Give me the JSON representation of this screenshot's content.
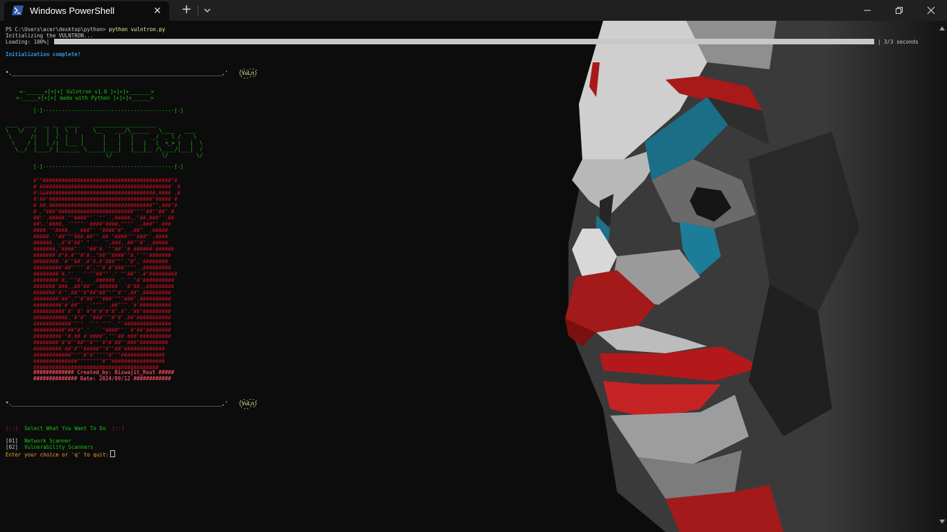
{
  "window": {
    "tab_title": "Windows PowerShell",
    "icons": {
      "tab_icon": "powershell-icon",
      "close": "close-icon",
      "new_tab": "plus-icon",
      "dropdown": "chevron-down-icon",
      "minimize": "minimize-icon",
      "maximize": "restore-icon",
      "close_window": "close-icon"
    },
    "colors": {
      "titlebar": "#202020",
      "terminal_bg": "#0c0c0c"
    }
  },
  "terminal": {
    "prompt": "PS C:\\Users\\acer\\desktop\\python>",
    "command": "python vulntron.py",
    "init_line": "Initializing the VULNTRON...",
    "loading_label": "Loading: 100%|",
    "loading_percent": 100,
    "loading_suffix": "| 3/3 seconds",
    "init_complete": "Initialization complete!",
    "divider_top": "*.___________________________________________________________________,'",
    "vuln_badge_top": ".-.--.",
    "vuln_badge": "(VuLn)",
    "vuln_badge_bottom": "'--''",
    "version_line": "<-______+[+[+[ Vulntron v1.0 ]+]+]+_______>",
    "python_line": "<-_____+[+[+[ made with Python ]+]+]+______>",
    "frame_line": "[-]------------------------------------------[-]",
    "banner": [
      "____  ____  __ __  _____    ____________________",
      "\\   \\/   /   |  |  \\  |     \\__    ___/\\______   \\____   ____",
      " \\      /|   |  /  |    |      |    |   |      _/  _ \\ /    \\",
      "  \\    / |   | /|  |___ |      |    |   |   |   (  <_> )   |  \\",
      "   \\__/  |____/ |_______ \\_____|____|   |___|__ /\\____/|___|  /",
      "                                \\/                \\/         \\/"
    ],
    "mask_lines": [
      "#\"\"#########################################\"#",
      "# ##########################################' #",
      "#!&&###################################,#### ,#",
      "#!##\"#################################\"##### #",
      "# ##,#################################\"\",###\"#",
      "# ,\"###\"########################\"\"\"\"##\"\"##\" #",
      "##\\'.#####.\"\"####\"\"`'\"\"`.,#####,.\"##,###\"',##",
      "##\\.'####,.'\"\"\"\"'`####\"####,\"\"\"\"`.,###\"'.###",
      "####.'\"####, _ ###\"' \"####\"#\", ,##\"  ,#####",
      "#####.'\"##\"\"\"###.##\"\" ## \"####\"\"'###\"',####",
      "######..,#\"#\"##\" \" ``  \",###,.##\"\"#\".,#####",
      "#######,'####\"' `\"##\"#.`\"\"##\"'# ######`######",
      "#######'#\"#,#\"\"#\"#,.\"##\"\"####\"\"#.\"`\"'#######",
      "########.'#'\"##'.#\"#,#\"###\"\"\".\"#\",'########",
      "#########'##\"'\"\"'#\",\"\"#`#\"###\"\"\"\".,#########",
      "########'#.\"'   \"'\"\"##\"\"'.\" \"\"##\"'.#\"#########",
      "########`#,'\"\"#,   .###### .\" ` \"#\"##########",
      "#######'###.,##\"##'`.###### .'#\"##.,#########",
      "#######`#'\",##\"\"#\"##\"##\"\"\"\"#'\",##\",#########",
      "########'##\",\"\"#\"##\"\"\"###'\"\"\"###\",##########",
      "#########'#'##\"` ,'\"\"\"` ,##\"\"\".'#'##########",
      "##########'#\" #\" #\"#\"#\"#\"#\".#\".'##\"#########",
      "###########,'#\"#\" \"###\"\"\"#\"#'.##\"###########",
      "############`\"'\"  \"'\" \"'\"  \"'###############",
      "##########\"##\"#\" '  ``\"####\"\"' #\"##\"########",
      "#########'\"#,## #'####\",\"\"'## ###\"##########",
      "########'#\"#\"\"##\"\"#\"\"'#\"#'##\"\"###\"#########",
      "#########'##\"#\"\"#####\"\"#\"\"##\"#############",
      "############\"'\"\"#\"#\"\"\"\"\"#\"\"\"##############",
      "##############\"\"\"\"\"\"\"\"#\"\"#################",
      "########################################"
    ],
    "created_by": "############# Created_by: Biswajit_Rout #####",
    "date_line": "############## Date: 2024/09/12 ############",
    "divider_bottom": "*.___________________________________________________________________,'",
    "menu_prefix": "[::]",
    "menu_title": "Select What You Want To Do",
    "menu_suffix": "[::]",
    "options": [
      {
        "num": "[01]",
        "label": "Network Scanner"
      },
      {
        "num": "[02]",
        "label": "Vulnerability Scanners"
      }
    ],
    "input_prompt": "Enter your choice or 'q' to quit:"
  }
}
